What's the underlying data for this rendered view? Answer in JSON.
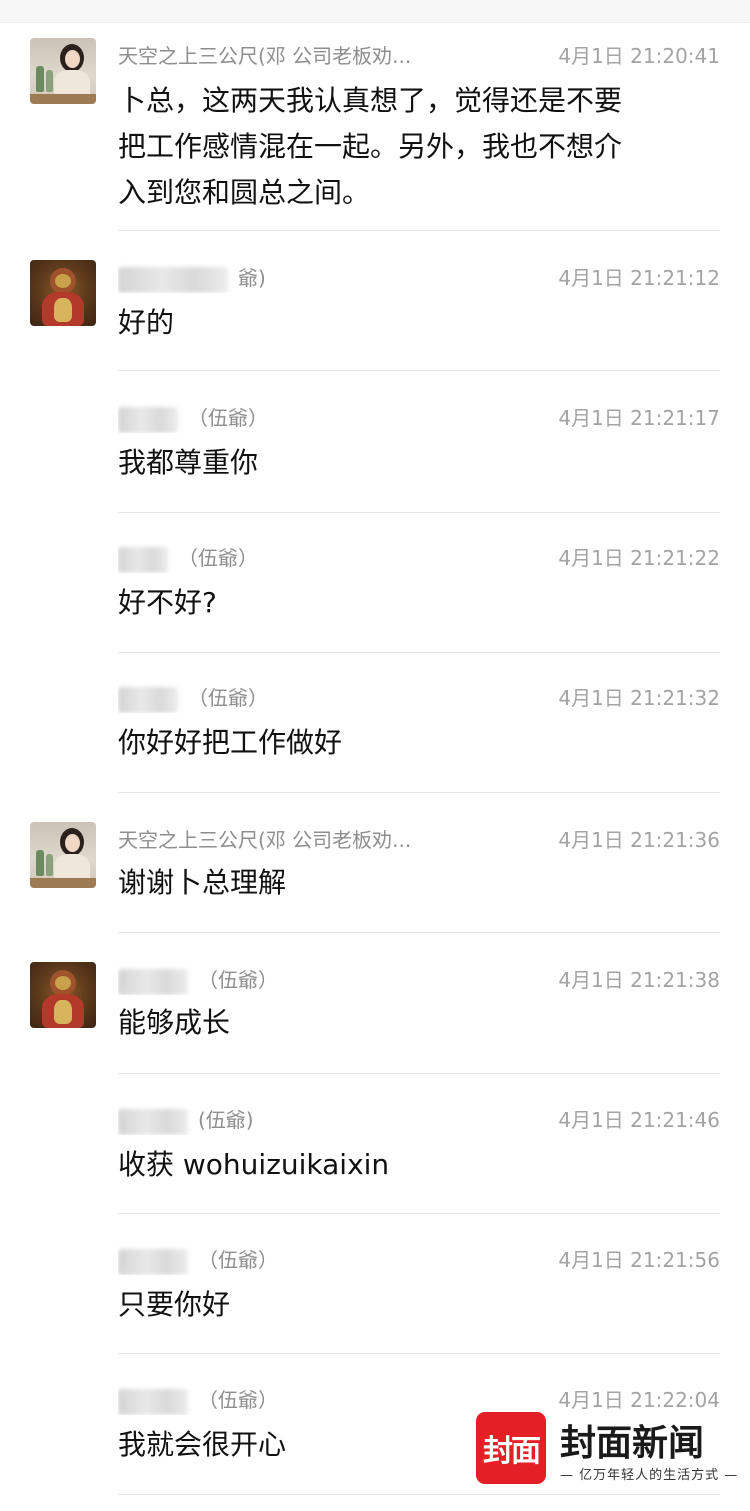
{
  "messages": [
    {
      "avatar": "woman-photo",
      "sender": "天空之上三公尺(邓 公司老板劝...",
      "sender_blurred": false,
      "time": "4月1日 21:20:41",
      "text": "卜总，这两天我认真想了，觉得还是不要\n把工作感情混在一起。另外，我也不想介\n入到您和圆总之间。"
    },
    {
      "avatar": "deity-statue",
      "sender": "爺)",
      "sender_blurred": true,
      "time": "4月1日 21:21:12",
      "text": "好的"
    },
    {
      "avatar": null,
      "sender": "（伍爺）",
      "sender_blurred": true,
      "time": "4月1日 21:21:17",
      "text": "我都尊重你"
    },
    {
      "avatar": null,
      "sender": "（伍爺）",
      "sender_blurred": true,
      "time": "4月1日 21:21:22",
      "text": "好不好?"
    },
    {
      "avatar": null,
      "sender": "（伍爺）",
      "sender_blurred": true,
      "time": "4月1日 21:21:32",
      "text": "你好好把工作做好"
    },
    {
      "avatar": "woman-photo",
      "sender": "天空之上三公尺(邓 公司老板劝...",
      "sender_blurred": false,
      "time": "4月1日 21:21:36",
      "text": "谢谢卜总理解"
    },
    {
      "avatar": "deity-statue",
      "sender": "（伍爺）",
      "sender_blurred": true,
      "time": "4月1日 21:21:38",
      "text": "能够成长"
    },
    {
      "avatar": null,
      "sender": "(伍爺)",
      "sender_blurred": true,
      "time": "4月1日 21:21:46",
      "text": "收获 wohuizuikaixin"
    },
    {
      "avatar": null,
      "sender": "（伍爺）",
      "sender_blurred": true,
      "time": "4月1日 21:21:56",
      "text": "只要你好"
    },
    {
      "avatar": null,
      "sender": "（伍爺）",
      "sender_blurred": true,
      "time": "4月1日 21:22:04",
      "text": "我就会很开心"
    }
  ],
  "watermark": {
    "logo_text": "封面",
    "title": "封面新闻",
    "subtitle": "— 亿万年轻人的生活方式 —",
    "logo_color": "#e41f26"
  }
}
